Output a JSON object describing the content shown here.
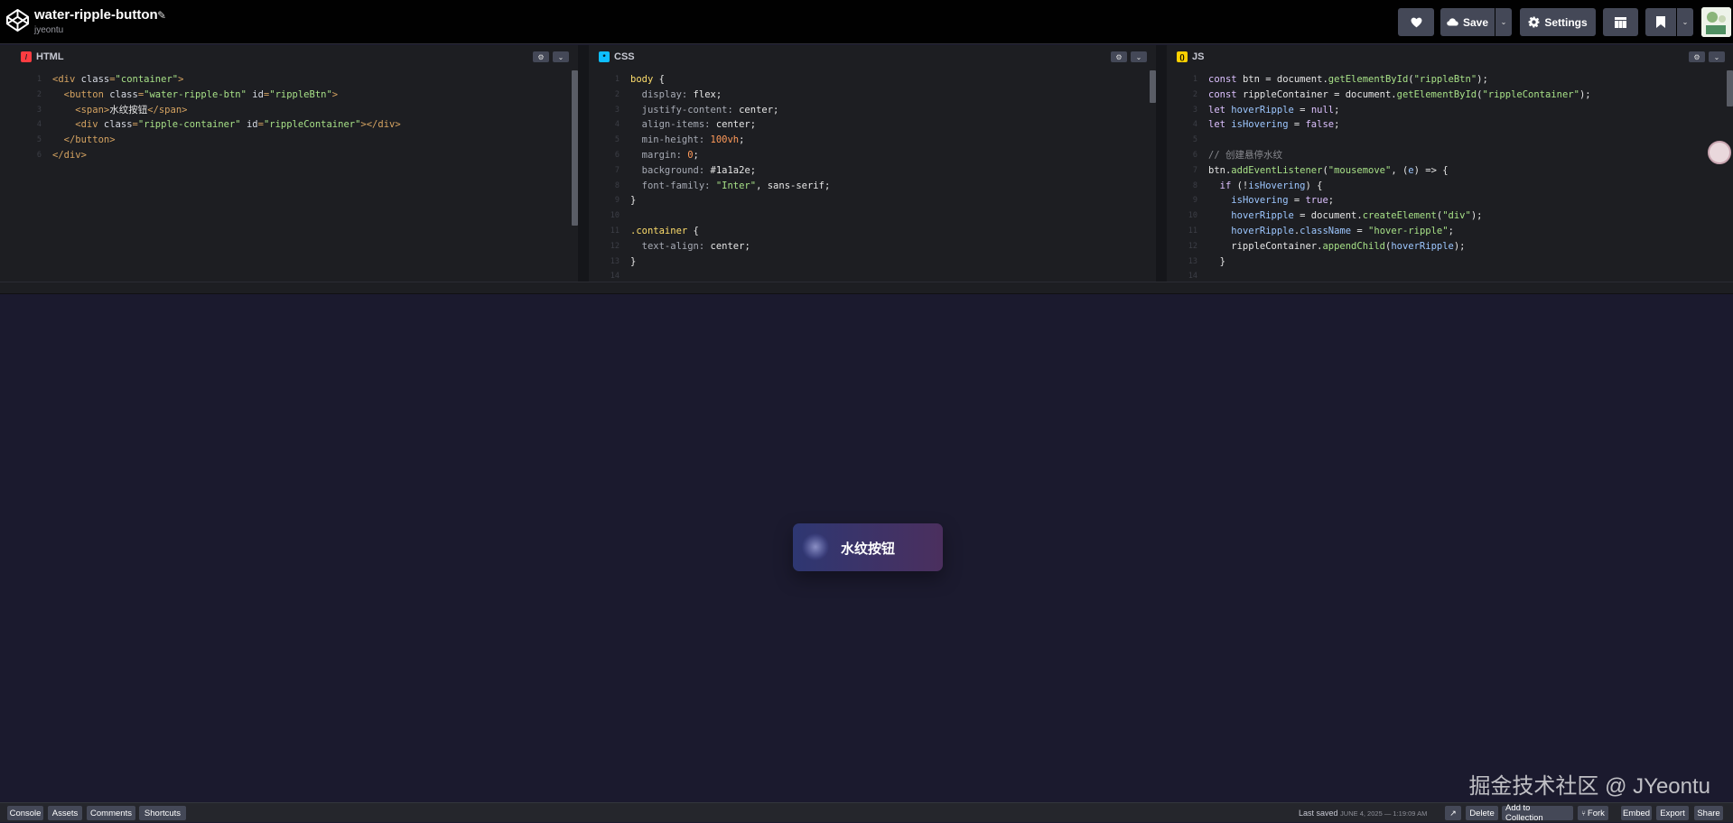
{
  "header": {
    "title": "water-ripple-button",
    "author": "jyeontu",
    "save_label": "Save",
    "settings_label": "Settings"
  },
  "html_pane": {
    "title": "HTML",
    "color": "#ff3c41",
    "lines": [
      {
        "n": "1",
        "parts": [
          [
            "t-tag",
            "<div "
          ],
          [
            "t-attr",
            "class"
          ],
          [
            "t-tag",
            "="
          ],
          [
            "t-str",
            "\"container\""
          ],
          [
            "t-tag",
            ">"
          ]
        ]
      },
      {
        "n": "2",
        "parts": [
          [
            "t-tag",
            "  <button "
          ],
          [
            "t-attr",
            "class"
          ],
          [
            "t-tag",
            "="
          ],
          [
            "t-str",
            "\"water-ripple-btn\""
          ],
          [
            "t-attr",
            " id"
          ],
          [
            "t-tag",
            "="
          ],
          [
            "t-str",
            "\"rippleBtn\""
          ],
          [
            "t-tag",
            ">"
          ]
        ]
      },
      {
        "n": "3",
        "parts": [
          [
            "t-tag",
            "    <span>"
          ],
          [
            "t-plain",
            "水纹按钮"
          ],
          [
            "t-tag",
            "</span>"
          ]
        ]
      },
      {
        "n": "4",
        "parts": [
          [
            "t-tag",
            "    <div "
          ],
          [
            "t-attr",
            "class"
          ],
          [
            "t-tag",
            "="
          ],
          [
            "t-str",
            "\"ripple-container\""
          ],
          [
            "t-attr",
            " id"
          ],
          [
            "t-tag",
            "="
          ],
          [
            "t-str",
            "\"rippleContainer\""
          ],
          [
            "t-tag",
            "></div>"
          ]
        ]
      },
      {
        "n": "5",
        "parts": [
          [
            "t-tag",
            "  </button>"
          ]
        ]
      },
      {
        "n": "6",
        "parts": [
          [
            "t-tag",
            "</div>"
          ]
        ]
      }
    ]
  },
  "css_pane": {
    "title": "CSS",
    "color": "#0ebeff",
    "lines": [
      {
        "n": "1",
        "parts": [
          [
            "t-sel",
            "body "
          ],
          [
            "t-plain",
            "{"
          ]
        ]
      },
      {
        "n": "2",
        "parts": [
          [
            "t-prop",
            "  display: "
          ],
          [
            "t-val",
            "flex;"
          ]
        ]
      },
      {
        "n": "3",
        "parts": [
          [
            "t-prop",
            "  justify-content: "
          ],
          [
            "t-val",
            "center;"
          ]
        ]
      },
      {
        "n": "4",
        "parts": [
          [
            "t-prop",
            "  align-items: "
          ],
          [
            "t-val",
            "center;"
          ]
        ]
      },
      {
        "n": "5",
        "parts": [
          [
            "t-prop",
            "  min-height: "
          ],
          [
            "t-num",
            "100vh"
          ],
          [
            "t-val",
            ";"
          ]
        ]
      },
      {
        "n": "6",
        "parts": [
          [
            "t-prop",
            "  margin: "
          ],
          [
            "t-num",
            "0"
          ],
          [
            "t-val",
            ";"
          ]
        ]
      },
      {
        "n": "7",
        "parts": [
          [
            "t-prop",
            "  background: "
          ],
          [
            "t-val",
            "#1a1a2e;"
          ]
        ]
      },
      {
        "n": "8",
        "parts": [
          [
            "t-prop",
            "  font-family: "
          ],
          [
            "t-str",
            "\"Inter\""
          ],
          [
            "t-val",
            ", sans-serif;"
          ]
        ]
      },
      {
        "n": "9",
        "parts": [
          [
            "t-plain",
            "}"
          ]
        ]
      },
      {
        "n": "10",
        "parts": []
      },
      {
        "n": "11",
        "parts": [
          [
            "t-sel",
            ".container "
          ],
          [
            "t-plain",
            "{"
          ]
        ]
      },
      {
        "n": "12",
        "parts": [
          [
            "t-prop",
            "  text-align: "
          ],
          [
            "t-val",
            "center;"
          ]
        ]
      },
      {
        "n": "13",
        "parts": [
          [
            "t-plain",
            "}"
          ]
        ]
      },
      {
        "n": "14",
        "parts": []
      }
    ]
  },
  "js_pane": {
    "title": "JS",
    "color": "#fcd000",
    "lines": [
      {
        "n": "1",
        "parts": [
          [
            "t-kw",
            "const "
          ],
          [
            "t-plain",
            "btn = document."
          ],
          [
            "t-fn",
            "getElementById"
          ],
          [
            "t-plain",
            "("
          ],
          [
            "t-str",
            "\"rippleBtn\""
          ],
          [
            "t-plain",
            ");"
          ]
        ]
      },
      {
        "n": "2",
        "parts": [
          [
            "t-kw",
            "const "
          ],
          [
            "t-plain",
            "rippleContainer = document."
          ],
          [
            "t-fn",
            "getElementById"
          ],
          [
            "t-plain",
            "("
          ],
          [
            "t-str",
            "\"rippleContainer\""
          ],
          [
            "t-plain",
            ");"
          ]
        ]
      },
      {
        "n": "3",
        "parts": [
          [
            "t-kw",
            "let "
          ],
          [
            "t-var",
            "hoverRipple"
          ],
          [
            "t-plain",
            " = "
          ],
          [
            "t-kw",
            "null"
          ],
          [
            "t-plain",
            ";"
          ]
        ]
      },
      {
        "n": "4",
        "parts": [
          [
            "t-kw",
            "let "
          ],
          [
            "t-var",
            "isHovering"
          ],
          [
            "t-plain",
            " = "
          ],
          [
            "t-kw",
            "false"
          ],
          [
            "t-plain",
            ";"
          ]
        ]
      },
      {
        "n": "5",
        "parts": []
      },
      {
        "n": "6",
        "parts": [
          [
            "t-cm",
            "// 创建悬停水纹"
          ]
        ]
      },
      {
        "n": "7",
        "parts": [
          [
            "t-plain",
            "btn."
          ],
          [
            "t-fn",
            "addEventListener"
          ],
          [
            "t-plain",
            "("
          ],
          [
            "t-str",
            "\"mousemove\""
          ],
          [
            "t-plain",
            ", ("
          ],
          [
            "t-var",
            "e"
          ],
          [
            "t-plain",
            ") => {"
          ]
        ]
      },
      {
        "n": "8",
        "parts": [
          [
            "t-kw",
            "  if "
          ],
          [
            "t-plain",
            "(!"
          ],
          [
            "t-var",
            "isHovering"
          ],
          [
            "t-plain",
            ") {"
          ]
        ]
      },
      {
        "n": "9",
        "parts": [
          [
            "t-plain",
            "    "
          ],
          [
            "t-var",
            "isHovering"
          ],
          [
            "t-plain",
            " = "
          ],
          [
            "t-kw",
            "true"
          ],
          [
            "t-plain",
            ";"
          ]
        ]
      },
      {
        "n": "10",
        "parts": [
          [
            "t-plain",
            "    "
          ],
          [
            "t-var",
            "hoverRipple"
          ],
          [
            "t-plain",
            " = document."
          ],
          [
            "t-fn",
            "createElement"
          ],
          [
            "t-plain",
            "("
          ],
          [
            "t-str",
            "\"div\""
          ],
          [
            "t-plain",
            ");"
          ]
        ]
      },
      {
        "n": "11",
        "parts": [
          [
            "t-plain",
            "    "
          ],
          [
            "t-var",
            "hoverRipple"
          ],
          [
            "t-plain",
            "."
          ],
          [
            "t-var",
            "className"
          ],
          [
            "t-plain",
            " = "
          ],
          [
            "t-str",
            "\"hover-ripple\""
          ],
          [
            "t-plain",
            ";"
          ]
        ]
      },
      {
        "n": "12",
        "parts": [
          [
            "t-plain",
            "    rippleContainer."
          ],
          [
            "t-fn",
            "appendChild"
          ],
          [
            "t-plain",
            "("
          ],
          [
            "t-var",
            "hoverRipple"
          ],
          [
            "t-plain",
            ");"
          ]
        ]
      },
      {
        "n": "13",
        "parts": [
          [
            "t-plain",
            "  }"
          ]
        ]
      },
      {
        "n": "14",
        "parts": []
      }
    ]
  },
  "preview": {
    "button_label": "水纹按钮",
    "watermark": "掘金技术社区 @ JYeontu"
  },
  "footer": {
    "console": "Console",
    "assets": "Assets",
    "comments": "Comments",
    "shortcuts": "Shortcuts",
    "saved_label": "Last saved",
    "saved_date": "JUNE 4, 2025 — 1:19:09 AM",
    "delete": "Delete",
    "add_to_collection": "Add to Collection",
    "fork": "Fork",
    "embed": "Embed",
    "export": "Export",
    "share": "Share"
  }
}
